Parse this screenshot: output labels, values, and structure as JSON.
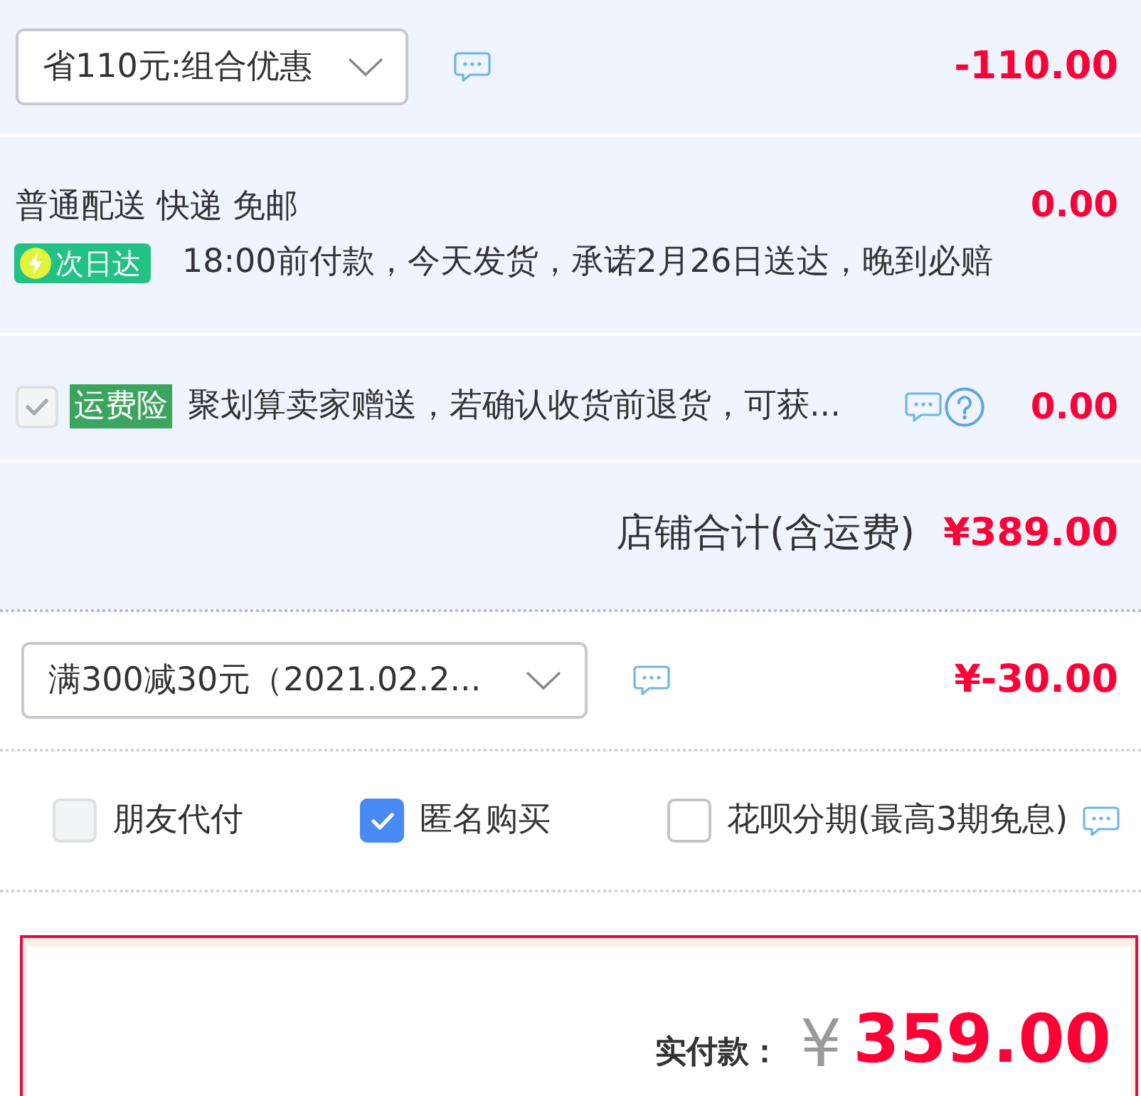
{
  "promotion": {
    "dropdown": "省110元:组合优惠",
    "amount": "-110.00"
  },
  "delivery": {
    "method": "普通配送 快递 免邮",
    "amount": "0.00",
    "badge": "次日达",
    "note": "18:00前付款，今天发货，承诺2月26日送达，晚到必赔"
  },
  "insurance": {
    "checked": true,
    "disabled": true,
    "badge": "运费险",
    "description": "聚划算卖家赠送，若确认收货前退货，可获...",
    "amount": "0.00"
  },
  "store_total": {
    "label": "店铺合计(含运费)",
    "amount": "¥389.00"
  },
  "coupon": {
    "dropdown": "满300减30元（2021.02.2...",
    "amount": "¥-30.00"
  },
  "options": [
    {
      "label": "朋友代付",
      "checked": false,
      "disabled": true
    },
    {
      "label": "匿名购买",
      "checked": true,
      "disabled": false
    },
    {
      "label": "花呗分期(最高3期免息)",
      "checked": false,
      "disabled": false
    }
  ],
  "payment": {
    "label": "实付款：",
    "currency": "¥",
    "amount": "359.00"
  }
}
